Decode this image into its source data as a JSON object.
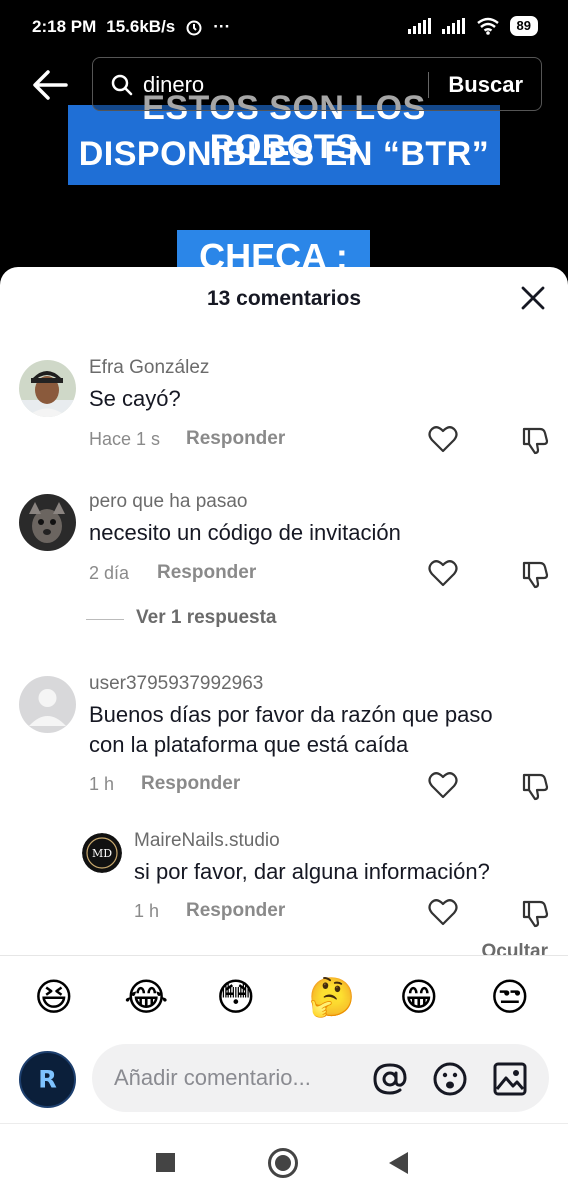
{
  "status_bar": {
    "time": "2:18 PM",
    "speed": "15.6kB/s",
    "dots": "···",
    "battery": "89"
  },
  "search": {
    "query": "dinero",
    "button": "Buscar"
  },
  "video": {
    "banner_line1": "ESTOS SON LOS ROBOTS",
    "banner_line2": "DISPONIBLES EN “BTR”",
    "banner_check": "CHECA :"
  },
  "sheet": {
    "title": "13 comentarios",
    "reply_label": "Responder",
    "view_replies": "Ver 1 respuesta",
    "hide": "Ocultar"
  },
  "comments": [
    {
      "user": "Efra González",
      "text": "Se cayó?",
      "time": "Hace 1 s"
    },
    {
      "user": "pero que ha pasao",
      "text": "necesito un código de invitación",
      "time": "2 día"
    },
    {
      "user": "user3795937992963",
      "text_line1": "Buenos días por favor da razón que paso",
      "text_line2": "con la plataforma que está caída",
      "time": "1 h"
    },
    {
      "user": "MaireNails.studio",
      "text": "si por favor, dar alguna información?",
      "time": "1 h",
      "avatar_text": "MD"
    }
  ],
  "emojis": [
    "😆",
    "😂",
    "😳",
    "🤔",
    "😁",
    "😒"
  ],
  "composer": {
    "placeholder": "Añadir comentario...",
    "avatar_text": "R"
  }
}
